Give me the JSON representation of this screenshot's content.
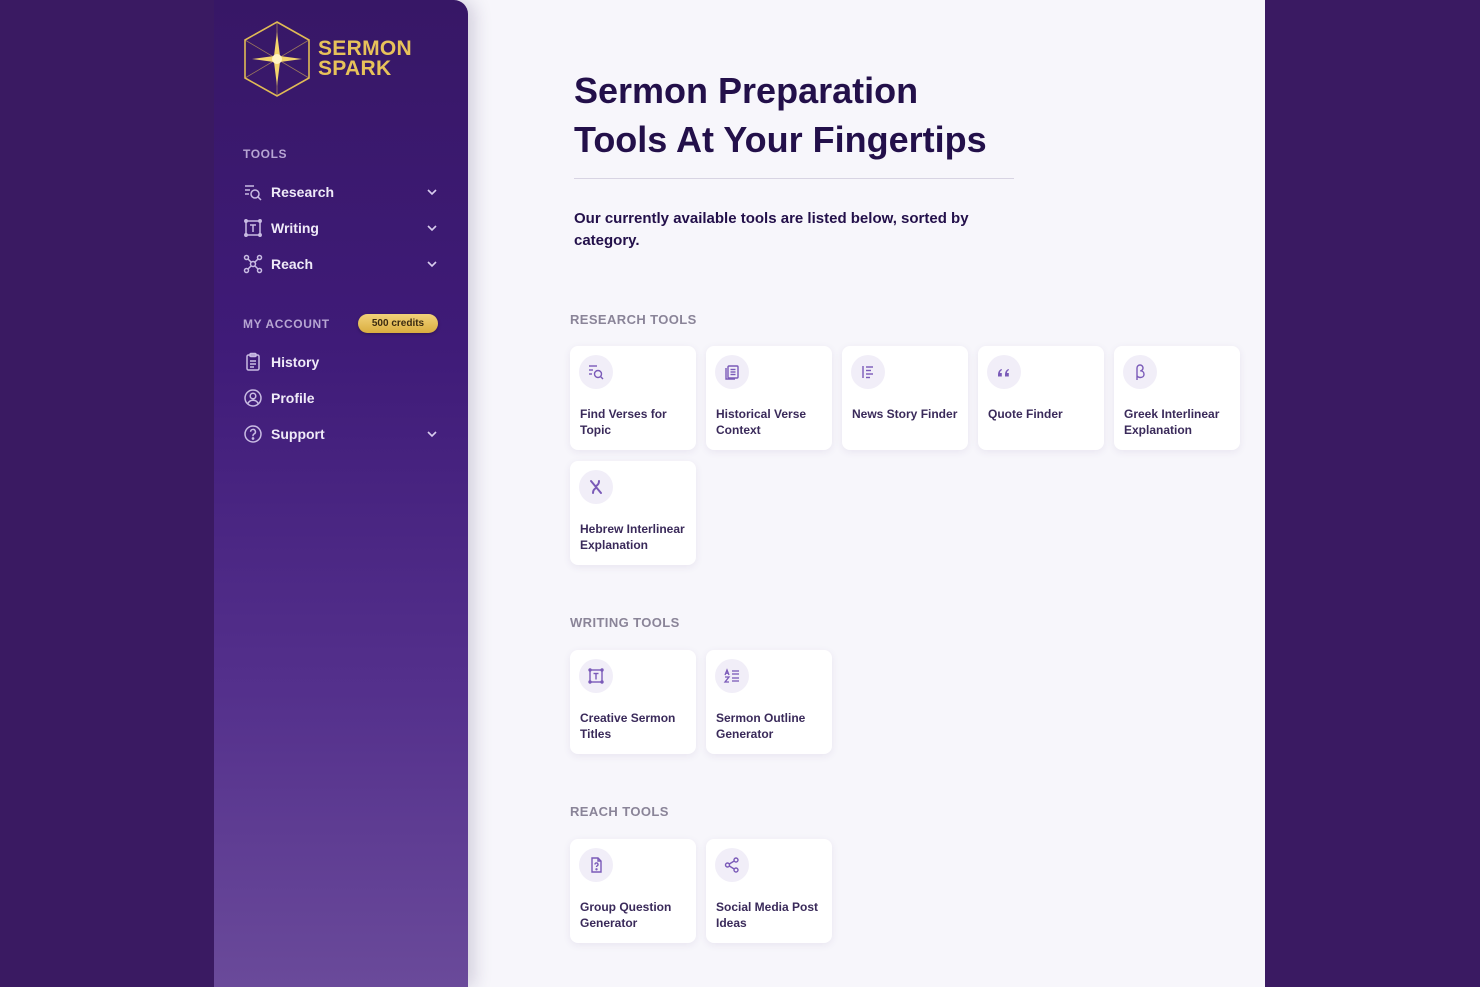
{
  "brand": {
    "line1": "SERMON",
    "line2": "SPARK"
  },
  "sidebar": {
    "tools_label": "TOOLS",
    "tools": [
      {
        "label": "Research",
        "icon": "search-list-icon"
      },
      {
        "label": "Writing",
        "icon": "text-frame-icon"
      },
      {
        "label": "Reach",
        "icon": "network-icon"
      }
    ],
    "account_label": "MY ACCOUNT",
    "credits": "500 credits",
    "account": [
      {
        "label": "History",
        "icon": "clipboard-icon"
      },
      {
        "label": "Profile",
        "icon": "user-circle-icon"
      },
      {
        "label": "Support",
        "icon": "help-circle-icon"
      }
    ]
  },
  "main": {
    "headline_line1": "Sermon Preparation",
    "headline_line2": "Tools At Your Fingertips",
    "intro": "Our currently available tools are listed below, sorted by category.",
    "categories": [
      {
        "label": "RESEARCH TOOLS",
        "tools": [
          {
            "title": "Find Verses for Topic",
            "icon": "search-list-icon"
          },
          {
            "title": "Historical Verse Context",
            "icon": "pages-icon"
          },
          {
            "title": "News Story Finder",
            "icon": "text-align-icon"
          },
          {
            "title": "Quote Finder",
            "icon": "quote-icon"
          },
          {
            "title": "Greek Interlinear Explanation",
            "icon": "beta-icon"
          },
          {
            "title": "Hebrew Interlinear Explanation",
            "icon": "aleph-icon"
          }
        ]
      },
      {
        "label": "WRITING TOOLS",
        "tools": [
          {
            "title": "Creative Sermon Titles",
            "icon": "text-frame-icon"
          },
          {
            "title": "Sermon Outline Generator",
            "icon": "outline-icon"
          }
        ]
      },
      {
        "label": "REACH TOOLS",
        "tools": [
          {
            "title": "Group Question Generator",
            "icon": "question-doc-icon"
          },
          {
            "title": "Social Media Post Ideas",
            "icon": "share-icon"
          }
        ]
      }
    ]
  },
  "colors": {
    "background": "#3a1a62",
    "sidebar_top": "#371766",
    "sidebar_bottom": "#6a4a9a",
    "accent_gold": "#e8c25a",
    "heading": "#23104a",
    "icon": "#7a5ab8"
  }
}
